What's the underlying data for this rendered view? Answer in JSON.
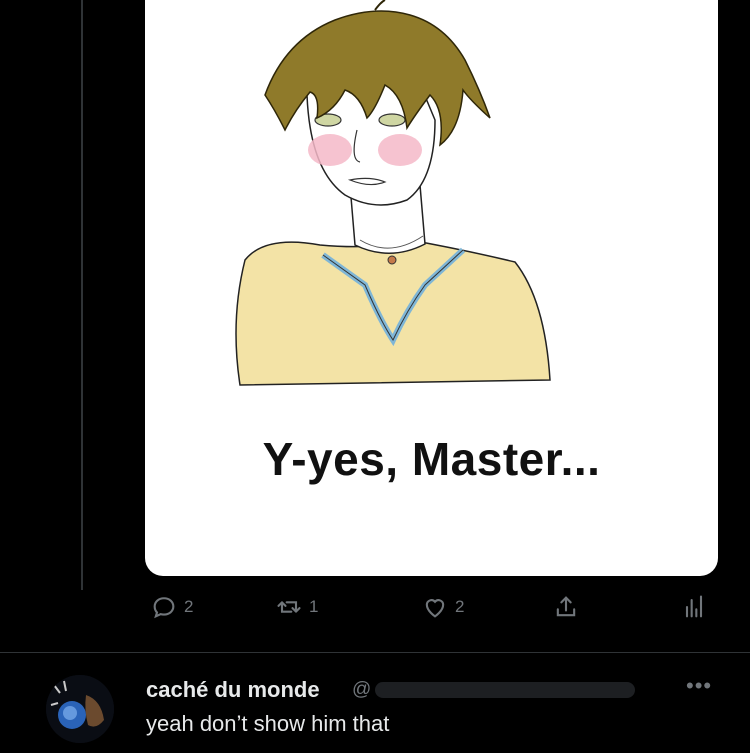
{
  "post": {
    "image_caption": "Y-yes, Master...",
    "actions": {
      "reply_count": "2",
      "retweet_count": "1",
      "like_count": "2"
    }
  },
  "reply": {
    "name": "caché du monde",
    "handle": "@",
    "text": "yeah don’t show him that",
    "more_label": "•••"
  },
  "colors": {
    "background": "#000000",
    "muted": "#71767b",
    "text": "#e7e9ea",
    "card": "#ffffff"
  },
  "icons": [
    "reply-icon",
    "retweet-icon",
    "like-icon",
    "share-icon",
    "views-icon",
    "more-icon"
  ]
}
